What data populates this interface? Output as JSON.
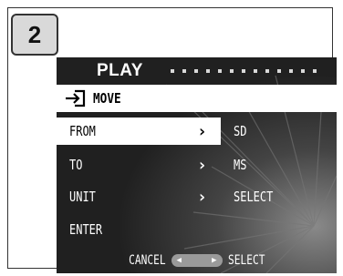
{
  "step": "2",
  "menu": {
    "title": "PLAY",
    "action": "MOVE",
    "rows": [
      {
        "name": "FROM",
        "arrow": "›",
        "value": "SD"
      },
      {
        "name": "TO",
        "arrow": "›",
        "value": "MS"
      },
      {
        "name": "UNIT",
        "arrow": "›",
        "value": "SELECT"
      },
      {
        "name": "ENTER",
        "arrow": "",
        "value": ""
      }
    ]
  },
  "footer": {
    "cancel": "CANCEL",
    "select": "SELECT"
  }
}
